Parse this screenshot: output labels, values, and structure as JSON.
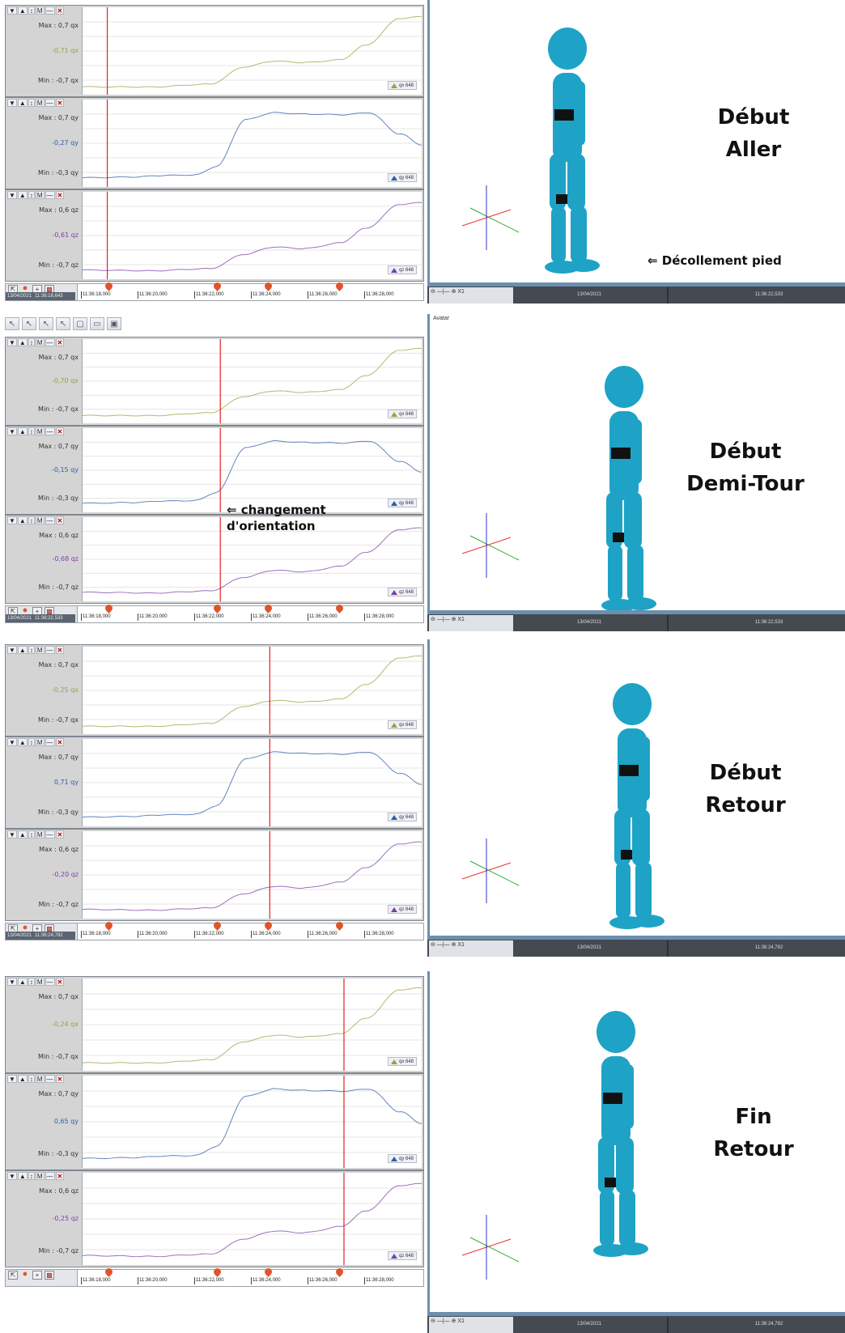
{
  "panels": [
    {
      "id": "p1",
      "phase_title": [
        "Début",
        "Aller"
      ],
      "annotation": "Décollement pied",
      "timeline_date": "13/04/2021",
      "timeline_time": "11:36:18,643",
      "avatar_date": "13/04/2021",
      "avatar_time": "11:36:22,533",
      "avatar_title": "",
      "charts": [
        {
          "max": "Max : 0,7 qx",
          "cur": "-0,71 qx",
          "min": "Min : -0,7 qx",
          "badge": "qx 648",
          "color": "#9aa23a"
        },
        {
          "max": "Max : 0,7 qy",
          "cur": "-0,27 qy",
          "min": "Min : -0,3 qy",
          "badge": "qy 648",
          "color": "#2e5ea8"
        },
        {
          "max": "Max : 0,6 qz",
          "cur": "-0,61 qz",
          "min": "Min : -0,7 qz",
          "badge": "qz 648",
          "color": "#7b3fa8"
        }
      ]
    },
    {
      "id": "p2",
      "phase_title": [
        "Début",
        "Demi-Tour"
      ],
      "annotation": "changement d'orientation",
      "timeline_date": "13/04/2021",
      "timeline_time": "11:36:22,533",
      "avatar_date": "13/04/2021",
      "avatar_time": "11:36:22,533",
      "avatar_title": "Avatar",
      "charts": [
        {
          "max": "Max : 0,7 qx",
          "cur": "-0,70 qx",
          "min": "Min : -0,7 qx",
          "badge": "qx 648",
          "color": "#9aa23a"
        },
        {
          "max": "Max : 0,7 qy",
          "cur": "-0,15 qy",
          "min": "Min : -0,3 qy",
          "badge": "qy 648",
          "color": "#2e5ea8"
        },
        {
          "max": "Max : 0,6 qz",
          "cur": "-0,68 qz",
          "min": "Min : -0,7 qz",
          "badge": "qz 648",
          "color": "#7b3fa8"
        }
      ]
    },
    {
      "id": "p3",
      "phase_title": [
        "Début",
        "Retour"
      ],
      "annotation": "",
      "timeline_date": "13/04/2021",
      "timeline_time": "11:36:24,782",
      "avatar_date": "13/04/2021",
      "avatar_time": "11:36:24,782",
      "avatar_title": "",
      "charts": [
        {
          "max": "Max : 0,7 qx",
          "cur": "-0,25 qx",
          "min": "Min : -0,7 qx",
          "badge": "qx 648",
          "color": "#9aa23a"
        },
        {
          "max": "Max : 0,7 qy",
          "cur": "0,71 qy",
          "min": "Min : -0,3 qy",
          "badge": "qy 648",
          "color": "#2e5ea8"
        },
        {
          "max": "Max : 0,6 qz",
          "cur": "-0,20 qz",
          "min": "Min : -0,7 qz",
          "badge": "qz 648",
          "color": "#7b3fa8"
        }
      ]
    },
    {
      "id": "p4",
      "phase_title": [
        "Fin",
        "Retour"
      ],
      "annotation": "",
      "timeline_date": "",
      "timeline_time": "",
      "avatar_date": "13/04/2021",
      "avatar_time": "11:36:24,782",
      "avatar_title": "",
      "charts": [
        {
          "max": "Max : 0,7 qx",
          "cur": "-0,24 qx",
          "min": "Min : -0,7 qx",
          "badge": "qx 648",
          "color": "#9aa23a"
        },
        {
          "max": "Max : 0,7 qy",
          "cur": "0,65 qy",
          "min": "Min : -0,3 qy",
          "badge": "qy 648",
          "color": "#2e5ea8"
        },
        {
          "max": "Max : 0,6 qz",
          "cur": "-0,25 qz",
          "min": "Min : -0,7 qz",
          "badge": "qz 648",
          "color": "#7b3fa8"
        }
      ]
    }
  ],
  "timeline_ticks": [
    "11:36:18,000",
    "11:36:20,000",
    "11:36:22,000",
    "11:36:24,000",
    "11:36:26,000",
    "11:36:28,000"
  ],
  "speed_label": "X1",
  "chart_data": {
    "type": "line",
    "x_unit": "time (s)",
    "series_shape": {
      "qx": [
        [
          0,
          0.02
        ],
        [
          2,
          0.02
        ],
        [
          3.6,
          0.06
        ],
        [
          4.6,
          0.3
        ],
        [
          5.4,
          0.38
        ],
        [
          6.3,
          0.36
        ],
        [
          7.3,
          0.4
        ],
        [
          8,
          0.6
        ],
        [
          9,
          0.98
        ],
        [
          9.6,
          1.0
        ]
      ],
      "qy": [
        [
          0,
          0.04
        ],
        [
          1.5,
          0.05
        ],
        [
          2.2,
          0.07
        ],
        [
          3.2,
          0.08
        ],
        [
          3.8,
          0.2
        ],
        [
          4.6,
          0.85
        ],
        [
          5.4,
          0.95
        ],
        [
          6.4,
          0.93
        ],
        [
          7.4,
          0.92
        ],
        [
          8.1,
          0.95
        ],
        [
          9.0,
          0.65
        ],
        [
          9.6,
          0.5
        ]
      ],
      "qz": [
        [
          0,
          0.04
        ],
        [
          2,
          0.03
        ],
        [
          3.6,
          0.06
        ],
        [
          4.6,
          0.26
        ],
        [
          5.4,
          0.36
        ],
        [
          6.3,
          0.34
        ],
        [
          7.3,
          0.42
        ],
        [
          8,
          0.62
        ],
        [
          9,
          0.96
        ],
        [
          9.6,
          0.98
        ]
      ]
    },
    "cursor_time": [
      0.7,
      3.9,
      5.3,
      7.4
    ],
    "x_range": [
      0,
      9.6
    ]
  }
}
